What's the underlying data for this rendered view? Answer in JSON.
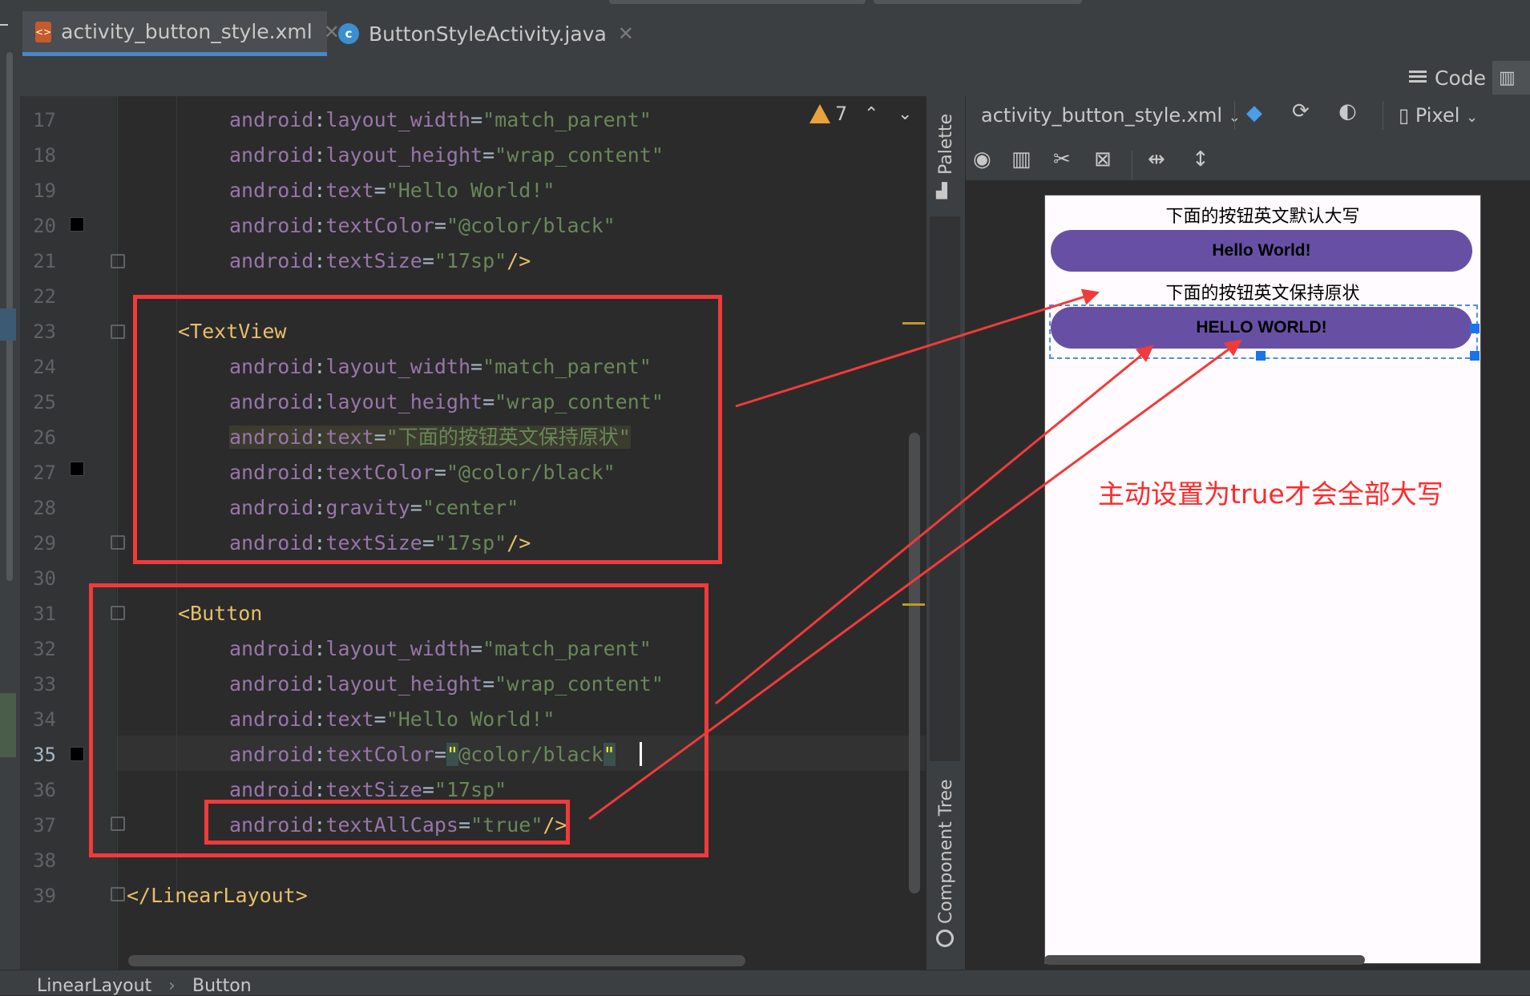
{
  "tabs": [
    {
      "label": "activity_button_style.xml",
      "close": "✕",
      "icon": "xml-file-icon",
      "active": true
    },
    {
      "label": "ButtonStyleActivity.java",
      "close": "✕",
      "icon": "java-class-icon",
      "active": false
    }
  ],
  "toolbar": {
    "code_label": "Code"
  },
  "editor": {
    "warnings_count": "7",
    "line_numbers": [
      "17",
      "18",
      "19",
      "20",
      "21",
      "22",
      "23",
      "24",
      "25",
      "26",
      "27",
      "28",
      "29",
      "30",
      "31",
      "32",
      "33",
      "34",
      "35",
      "36",
      "37",
      "38",
      "39"
    ],
    "current_line": "35",
    "lines": [
      {
        "n": "17",
        "attr": "android",
        "name": "layout_width",
        "value": "\"match_parent\"",
        "tail": ""
      },
      {
        "n": "18",
        "attr": "android",
        "name": "layout_height",
        "value": "\"wrap_content\"",
        "tail": ""
      },
      {
        "n": "19",
        "attr": "android",
        "name": "text",
        "value": "\"Hello World!\"",
        "tail": ""
      },
      {
        "n": "20",
        "attr": "android",
        "name": "textColor",
        "value": "\"@color/black\"",
        "tail": ""
      },
      {
        "n": "21",
        "attr": "android",
        "name": "textSize",
        "value": "\"17sp\"",
        "tail": "/>"
      },
      {
        "n": "23",
        "tag": "<TextView"
      },
      {
        "n": "24",
        "attr": "android",
        "name": "layout_width",
        "value": "\"match_parent\"",
        "tail": ""
      },
      {
        "n": "25",
        "attr": "android",
        "name": "layout_height",
        "value": "\"wrap_content\"",
        "tail": ""
      },
      {
        "n": "26",
        "attr": "android",
        "name": "text",
        "value": "\"下面的按钮英文保持原状\"",
        "tail": ""
      },
      {
        "n": "27",
        "attr": "android",
        "name": "textColor",
        "value": "\"@color/black\"",
        "tail": ""
      },
      {
        "n": "28",
        "attr": "android",
        "name": "gravity",
        "value": "\"center\"",
        "tail": ""
      },
      {
        "n": "29",
        "attr": "android",
        "name": "textSize",
        "value": "\"17sp\"",
        "tail": "/>"
      },
      {
        "n": "31",
        "tag": "<Button"
      },
      {
        "n": "32",
        "attr": "android",
        "name": "layout_width",
        "value": "\"match_parent\"",
        "tail": ""
      },
      {
        "n": "33",
        "attr": "android",
        "name": "layout_height",
        "value": "\"wrap_content\"",
        "tail": ""
      },
      {
        "n": "34",
        "attr": "android",
        "name": "text",
        "value": "\"Hello World!\"",
        "tail": ""
      },
      {
        "n": "35",
        "attr": "android",
        "name": "textColor",
        "value": "@color/black",
        "tail": ""
      },
      {
        "n": "36",
        "attr": "android",
        "name": "textSize",
        "value": "\"17sp\"",
        "tail": ""
      },
      {
        "n": "37",
        "attr": "android",
        "name": "textAllCaps",
        "value": "\"true\"",
        "tail": "/>"
      },
      {
        "n": "39",
        "tag": "</LinearLayout>"
      }
    ]
  },
  "side_tools": {
    "palette": "Palette",
    "component_tree": "Component Tree"
  },
  "design": {
    "file_label": "activity_button_style.xml",
    "device_label": "Pixel",
    "preview": {
      "text1": "下面的按钮英文默认大写",
      "button1": "Hello World!",
      "text2": "下面的按钮英文保持原状",
      "button2": "HELLO WORLD!"
    },
    "button_color": "#6750a4"
  },
  "annotation": {
    "text": "主动设置为true才会全部大写",
    "color": "#ff2a2a"
  },
  "breadcrumb": {
    "item1": "LinearLayout",
    "separator": "›",
    "item2": "Button"
  }
}
